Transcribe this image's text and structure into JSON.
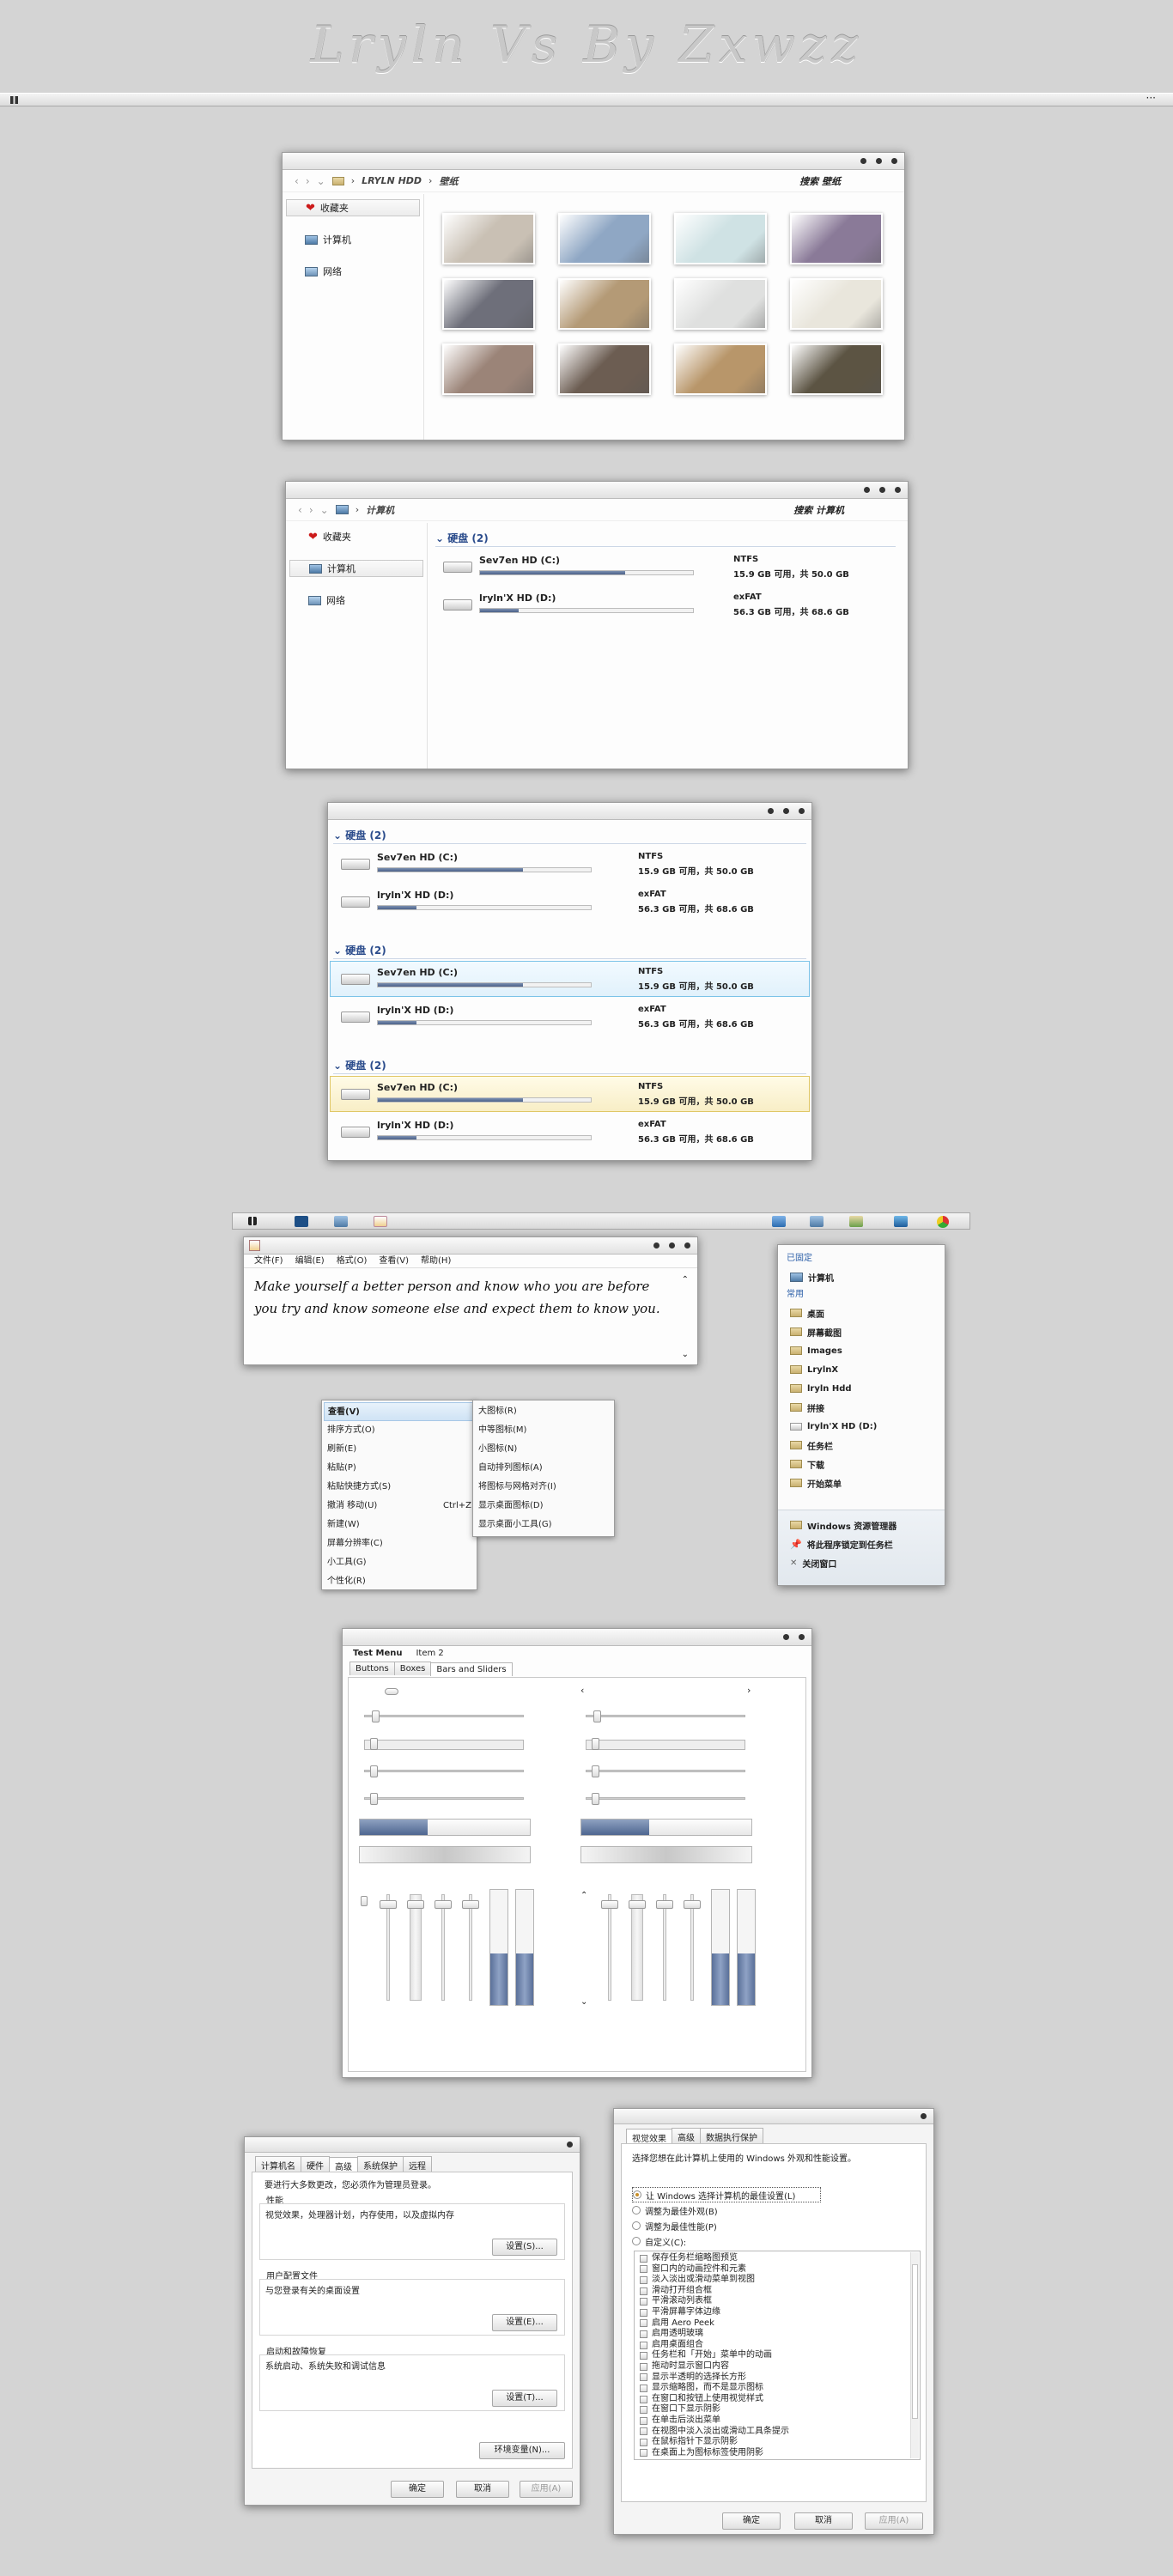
{
  "banner": {
    "title": "Lryln Vs By Zxwzz"
  },
  "topbar": {
    "left_icon": "grid-icon",
    "right_text": "···"
  },
  "explorer1": {
    "breadcrumb": [
      "LRYLN HDD",
      "壁纸"
    ],
    "search": "搜索 壁纸",
    "sidebar": [
      "收藏夹",
      "计算机",
      "网络"
    ],
    "thumbs": [
      "#c9c0b4",
      "#8fa7c4",
      "#cfe2e4",
      "#8a7a98",
      "#6e6f7a",
      "#b49a76",
      "#dfe0df",
      "#e9e6dc",
      "#9b8478",
      "#6c5d52",
      "#b8966a",
      "#5c5443"
    ]
  },
  "explorer2": {
    "breadcrumb": [
      "计算机"
    ],
    "search": "搜索 计算机",
    "sidebar": [
      "收藏夹",
      "计算机",
      "网络"
    ],
    "group": "硬盘 (2)",
    "drives": [
      {
        "name": "Sev7en HD (C:)",
        "fs": "NTFS",
        "cap": "15.9 GB 可用，共 50.0 GB",
        "used": 0.68
      },
      {
        "name": "lryln'X HD (D:)",
        "fs": "exFAT",
        "cap": "56.3 GB 可用，共 68.6 GB",
        "used": 0.18
      }
    ]
  },
  "drives_window": {
    "groups": [
      {
        "title": "硬盘 (2)",
        "style": "plain"
      },
      {
        "title": "硬盘 (2)",
        "style": "blue"
      },
      {
        "title": "硬盘 (2)",
        "style": "yellow"
      }
    ],
    "drives": [
      {
        "name": "Sev7en HD (C:)",
        "fs": "NTFS",
        "cap": "15.9 GB 可用，共 50.0 GB",
        "used": 0.68
      },
      {
        "name": "lryln'X HD (D:)",
        "fs": "exFAT",
        "cap": "56.3 GB 可用，共 68.6 GB",
        "used": 0.18
      }
    ]
  },
  "taskbar": {
    "icons": [
      "start-grid-icon",
      "photoshop-icon",
      "computer-icon",
      "notepad-icon",
      "monitor-icon",
      "computer-icon",
      "explorer-icon",
      "media-icon",
      "chrome-icon"
    ]
  },
  "notepad": {
    "menus": [
      "文件(F)",
      "编辑(E)",
      "格式(O)",
      "查看(V)",
      "帮助(H)"
    ],
    "text": "Make yourself a better person and know who you are before you try and know someone else and expect them to know you."
  },
  "context_menu": {
    "items": [
      "查看(V)",
      "排序方式(O)",
      "刷新(E)",
      "粘贴(P)",
      "粘贴快捷方式(S)",
      "撤消 移动(U)",
      "新建(W)",
      "屏幕分辨率(C)",
      "小工具(G)",
      "个性化(R)"
    ],
    "undo_shortcut": "Ctrl+Z",
    "submenu": [
      "大图标(R)",
      "中等图标(M)",
      "小图标(N)",
      "自动排列图标(A)",
      "将图标与网格对齐(I)",
      "显示桌面图标(D)",
      "显示桌面小工具(G)"
    ]
  },
  "jumplist": {
    "pinned_header": "已固定",
    "pinned": [
      "计算机"
    ],
    "frequent_header": "常用",
    "frequent": [
      "桌面",
      "屏幕截图",
      "Images",
      "LrylnX",
      "lryln Hdd",
      "拼接",
      "lryln'X HD (D:)",
      "任务栏",
      "下载",
      "开始菜单"
    ],
    "tasks": [
      "Windows 资源管理器",
      "将此程序锁定到任务栏",
      "关闭窗口"
    ]
  },
  "test_window": {
    "menus": [
      "Test Menu",
      "Item 2"
    ],
    "tabs": [
      "Buttons",
      "Boxes",
      "Bars and Sliders"
    ],
    "h_sliders": [
      0.05,
      0.04,
      0.04,
      0.04
    ],
    "progress": [
      0.4,
      0.4
    ],
    "v_sliders": [
      0.06,
      0.06,
      0.06,
      0.06
    ],
    "v_progress": [
      0.45,
      0.45
    ]
  },
  "sysprops": {
    "tabs": [
      "计算机名",
      "硬件",
      "高级",
      "系统保护",
      "远程"
    ],
    "intro": "要进行大多数更改，您必须作为管理员登录。",
    "sections": [
      {
        "title": "性能",
        "desc": "视觉效果，处理器计划，内存使用，以及虚拟内存",
        "button": "设置(S)..."
      },
      {
        "title": "用户配置文件",
        "desc": "与您登录有关的桌面设置",
        "button": "设置(E)..."
      },
      {
        "title": "启动和故障恢复",
        "desc": "系统启动、系统失败和调试信息",
        "button": "设置(T)..."
      }
    ],
    "env_button": "环境变量(N)...",
    "ok": "确定",
    "cancel": "取消",
    "apply": "应用(A)"
  },
  "perf": {
    "tabs": [
      "视觉效果",
      "高级",
      "数据执行保护"
    ],
    "intro": "选择您想在此计算机上使用的 Windows 外观和性能设置。",
    "options": [
      "让 Windows 选择计算机的最佳设置(L)",
      "调整为最佳外观(B)",
      "调整为最佳性能(P)",
      "自定义(C):"
    ],
    "checks": [
      "保存任务栏缩略图预览",
      "窗口内的动画控件和元素",
      "淡入淡出或滑动菜单到视图",
      "滑动打开组合框",
      "平滑滚动列表框",
      "平滑屏幕字体边缘",
      "启用 Aero Peek",
      "启用透明玻璃",
      "启用桌面组合",
      "任务栏和「开始」菜单中的动画",
      "拖动时显示窗口内容",
      "显示半透明的选择长方形",
      "显示缩略图，而不是显示图标",
      "在窗口和按钮上使用视觉样式",
      "在窗口下显示阴影",
      "在单击后淡出菜单",
      "在视图中淡入淡出或滑动工具条提示",
      "在鼠标指针下显示阴影",
      "在桌面上为图标标签使用阴影"
    ],
    "ok": "确定",
    "cancel": "取消",
    "apply": "应用(A)"
  }
}
